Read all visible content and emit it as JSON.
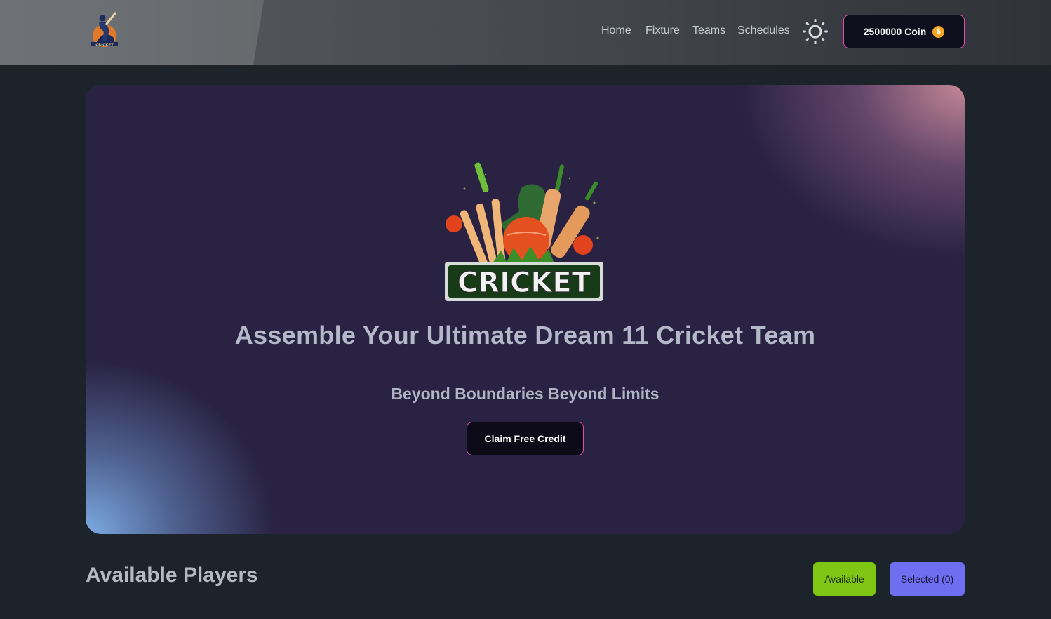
{
  "header": {
    "logo_icon": "cricket-batsman-logo",
    "logo_text": "CRICKET",
    "nav": [
      {
        "label": "Home"
      },
      {
        "label": "Fixture"
      },
      {
        "label": "Teams"
      },
      {
        "label": "Schedules"
      }
    ],
    "theme_icon": "sun-icon",
    "coin_label": "2500000 Coin",
    "coin_icon": "dollar-coin-icon",
    "coin_icon_glyph": "$",
    "accent_color": "#e04bb0"
  },
  "hero": {
    "banner_text": "CRICKET",
    "title": "Assemble Your Ultimate Dream 11 Cricket Team",
    "subtitle": "Beyond Boundaries Beyond Limits",
    "cta_label": "Claim Free Credit"
  },
  "players_section": {
    "title": "Available Players",
    "available_label": "Available",
    "selected_label": "Selected (0)",
    "available_color": "#7fc514",
    "selected_color": "#6e6ef0"
  }
}
